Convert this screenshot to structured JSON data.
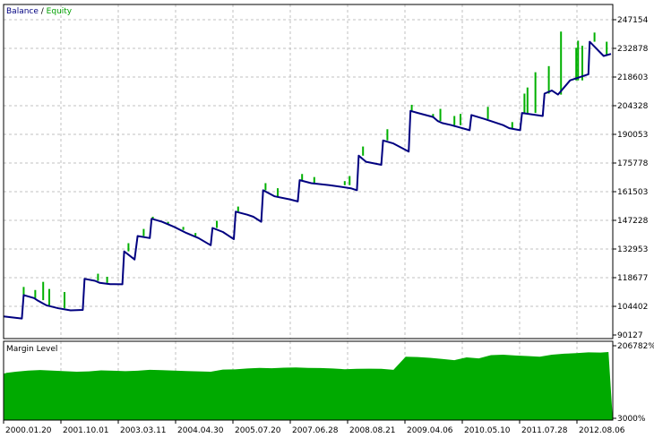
{
  "legend": {
    "balance": "Balance",
    "separator": " / ",
    "equity": "Equity"
  },
  "margin_panel": {
    "title": "Margin Level"
  },
  "colors": {
    "balance": "#000080",
    "equity": "#00b000",
    "margin_fill": "#00aa00",
    "grid": "#c0c0c0",
    "frame": "#000000"
  },
  "chart_data": [
    {
      "type": "line",
      "y_ticks": [
        "247154",
        "232878",
        "218603",
        "204328",
        "190053",
        "175778",
        "161503",
        "147228",
        "132953",
        "118677",
        "104402",
        "90127"
      ],
      "ylim": [
        90127,
        254291
      ],
      "xlim": [
        0,
        100
      ],
      "grid": true,
      "legend_position": "top-left",
      "series": [
        {
          "name": "Balance",
          "x": [
            0,
            3,
            3.3,
            5,
            5.5,
            7,
            9,
            11,
            13,
            13.3,
            15,
            15.8,
            17.5,
            19.5,
            19.8,
            21.5,
            22,
            24,
            24.3,
            26,
            28,
            30,
            32,
            34,
            34.3,
            36,
            37.8,
            38.1,
            40,
            41,
            42.3,
            42.6,
            44.5,
            47,
            48.3,
            48.6,
            50.5,
            53.5,
            57,
            58,
            58.3,
            59.5,
            62,
            62.3,
            64,
            66.5,
            66.8,
            68,
            70.5,
            71.3,
            72,
            73.5,
            76.5,
            76.8,
            79,
            82,
            83,
            84.8,
            85.1,
            88.5,
            88.8,
            90,
            91,
            93,
            96,
            96.2,
            98.5,
            99.7
          ],
          "y": [
            101000,
            100000,
            111500,
            110000,
            109000,
            106500,
            105000,
            104000,
            104200,
            119500,
            118500,
            117500,
            116900,
            116800,
            133000,
            129000,
            140500,
            139500,
            149000,
            147500,
            145000,
            142000,
            139500,
            136000,
            144500,
            142500,
            139000,
            152500,
            151000,
            150000,
            147500,
            163000,
            160000,
            158500,
            157500,
            168000,
            166500,
            165500,
            164000,
            163000,
            180000,
            177000,
            175500,
            187500,
            186000,
            182000,
            202000,
            201000,
            199000,
            197000,
            196000,
            195000,
            192500,
            200000,
            198000,
            195000,
            193500,
            192500,
            201000,
            199500,
            210500,
            212000,
            210000,
            217000,
            220000,
            236000,
            229000,
            230000
          ]
        },
        {
          "name": "Equity",
          "x": [
            3.3,
            5.2,
            6.5,
            7.5,
            10,
            15.5,
            17,
            20.5,
            23,
            24.5,
            27,
            29.5,
            31.5,
            35,
            38.5,
            43,
            45,
            49,
            51,
            56,
            56.8,
            59,
            63,
            67,
            70.5,
            71.7,
            74,
            75,
            79.5,
            83.5,
            85.5,
            86,
            87.3,
            89.5,
            91.5,
            94,
            94.3,
            95,
            97,
            99
          ],
          "y": [
            115500,
            114000,
            118000,
            114500,
            113000,
            122000,
            120500,
            137000,
            144000,
            150000,
            146000,
            143500,
            140500,
            148000,
            155000,
            166500,
            164000,
            171000,
            169500,
            167500,
            170000,
            184500,
            193000,
            205000,
            200500,
            203000,
            199500,
            200500,
            204000,
            196500,
            210500,
            213500,
            221000,
            224000,
            241000,
            233000,
            236500,
            234000,
            240500,
            236000
          ]
        }
      ]
    },
    {
      "type": "area",
      "title": "Margin Level",
      "y_ticks": [
        "206782%",
        "3000%"
      ],
      "ylim": [
        3000,
        206782
      ],
      "x_labels": [
        "2000.01.20",
        "2001.10.01",
        "2003.03.11",
        "2004.04.30",
        "2005.07.20",
        "2007.06.28",
        "2008.08.21",
        "2009.04.06",
        "2010.05.10",
        "2011.07.28",
        "2012.08.06"
      ],
      "xlim": [
        0,
        100
      ],
      "grid": true,
      "series": [
        {
          "name": "Margin Level",
          "x": [
            0,
            0.5,
            2,
            4,
            6,
            8,
            10,
            12,
            14,
            16,
            18,
            20,
            22,
            24,
            26,
            28,
            30,
            32,
            34,
            36,
            38,
            40,
            42,
            44,
            46,
            48,
            50,
            52,
            54,
            56,
            58,
            60,
            62,
            64,
            66,
            68,
            70,
            72,
            74,
            76,
            78,
            80,
            82,
            84,
            86,
            88,
            90,
            92,
            94,
            96,
            98,
            99.3,
            100
          ],
          "y": [
            123000,
            125000,
            128000,
            131000,
            132500,
            131000,
            129500,
            128000,
            129000,
            131500,
            130500,
            129500,
            130500,
            133000,
            132000,
            131000,
            130000,
            129000,
            128000,
            133500,
            134000,
            136500,
            138000,
            137000,
            138500,
            139000,
            138000,
            137500,
            136500,
            134500,
            135500,
            136000,
            135500,
            133000,
            167000,
            166000,
            164000,
            161000,
            158000,
            165000,
            162500,
            171000,
            172000,
            170000,
            168500,
            167000,
            172000,
            174500,
            176000,
            178000,
            177500,
            179000,
            3000
          ]
        }
      ]
    }
  ]
}
